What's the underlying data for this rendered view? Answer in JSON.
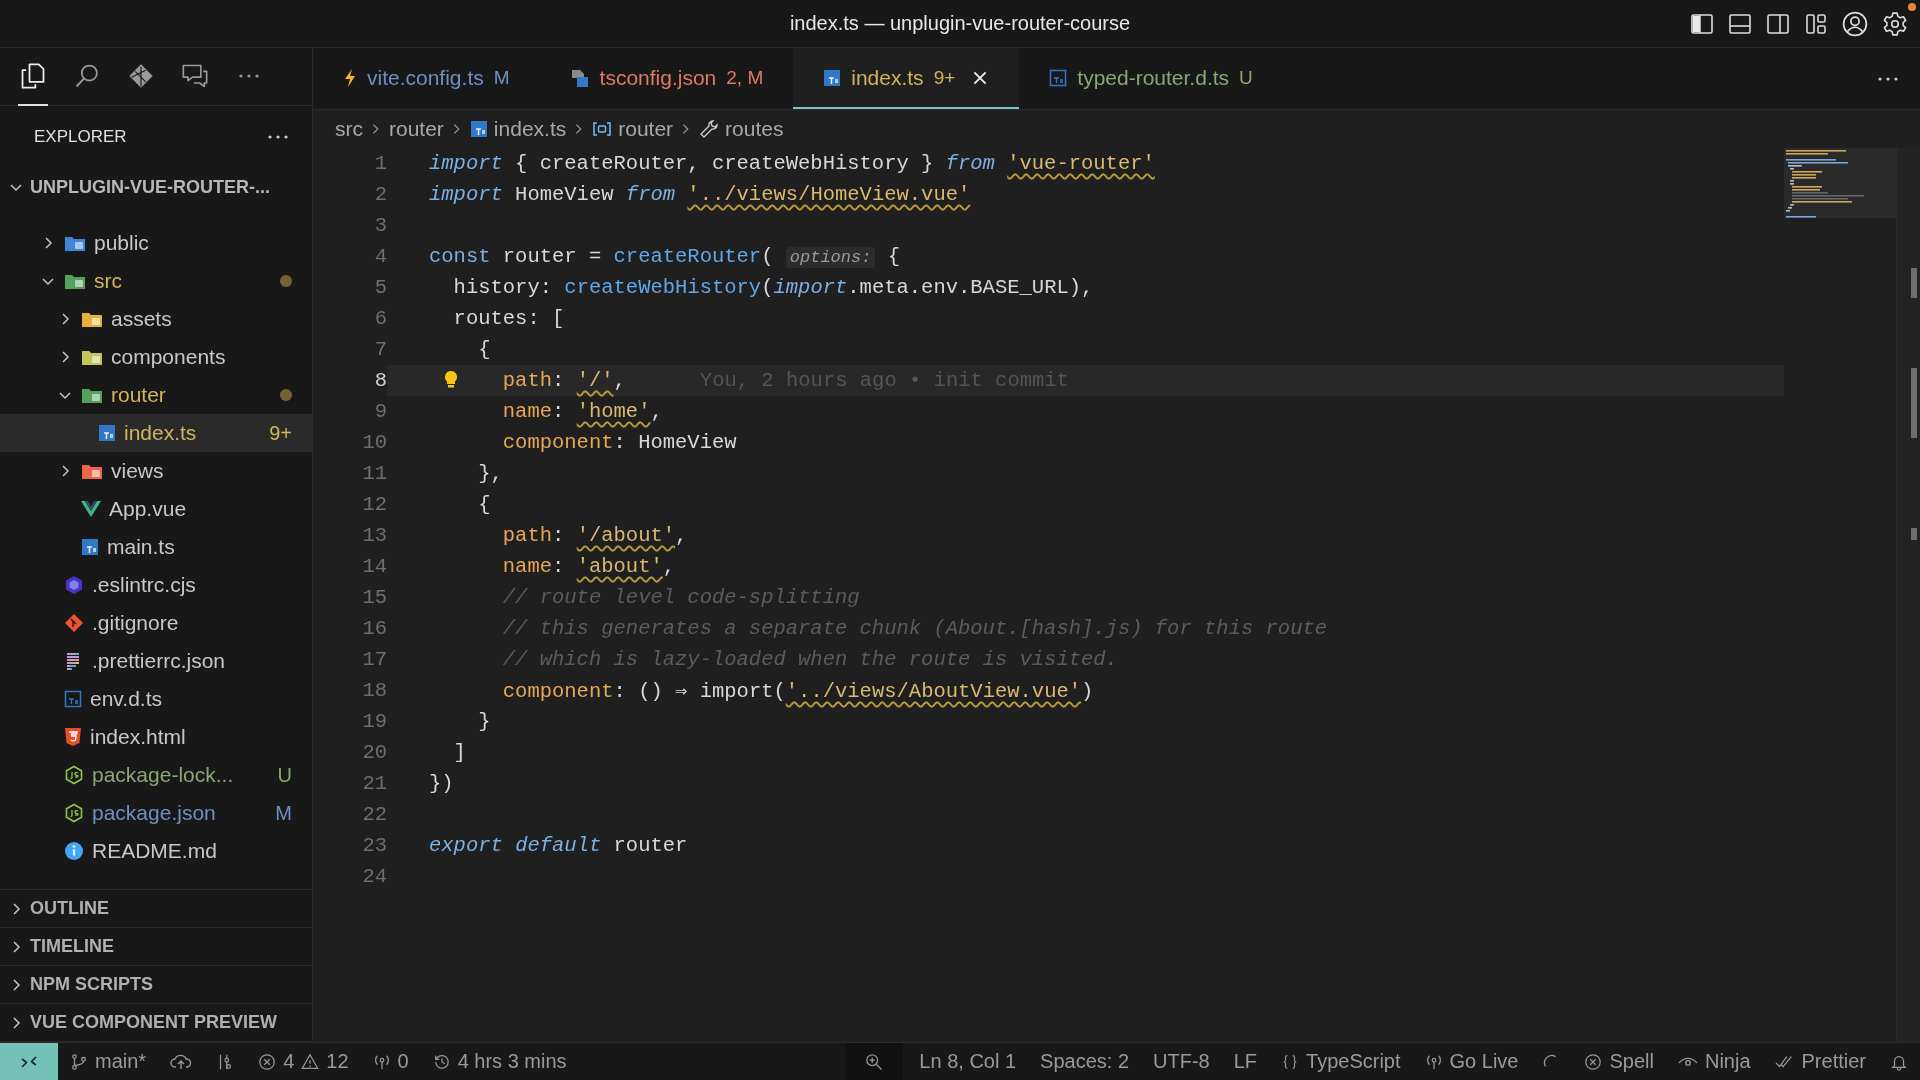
{
  "window": {
    "title": "index.ts — unplugin-vue-router-course"
  },
  "title_actions": [
    {
      "kind": "sidebar",
      "on": true
    },
    {
      "kind": "panel",
      "on": false
    },
    {
      "kind": "split",
      "on": false
    },
    {
      "kind": "layout",
      "on": false
    },
    {
      "kind": "account",
      "on": false
    },
    {
      "kind": "settings",
      "on": false,
      "notify": true
    }
  ],
  "activity": [
    {
      "kind": "files",
      "selected": true
    },
    {
      "kind": "search",
      "selected": false
    },
    {
      "kind": "diamond",
      "selected": false
    },
    {
      "kind": "chat",
      "selected": false
    },
    {
      "kind": "more",
      "selected": false
    }
  ],
  "explorer": {
    "title": "EXPLORER",
    "root": {
      "label": "UNPLUGIN-VUE-ROUTER-...",
      "expanded": true
    },
    "items": [
      {
        "label": "public",
        "kind": "folder-web",
        "expanded": false,
        "selected": false
      },
      {
        "label": "src",
        "kind": "folder-code",
        "expanded": true,
        "color": "#d2b45a",
        "dot": true,
        "selected": false,
        "children": [
          {
            "label": "assets",
            "kind": "folder-assets",
            "expanded": false,
            "selected": false
          },
          {
            "label": "components",
            "kind": "folder-components",
            "expanded": false,
            "selected": false
          },
          {
            "label": "router",
            "kind": "folder-router",
            "expanded": true,
            "color": "#d2b45a",
            "dot": true,
            "selected": false,
            "children": [
              {
                "label": "index.ts",
                "kind": "ts",
                "color": "#d2b45a",
                "badge": "9+",
                "selected": true
              }
            ]
          },
          {
            "label": "views",
            "kind": "folder-views",
            "expanded": false,
            "selected": false
          },
          {
            "label": "App.vue",
            "kind": "vue",
            "selected": false
          },
          {
            "label": "main.ts",
            "kind": "ts",
            "selected": false
          }
        ]
      },
      {
        "label": ".eslintrc.cjs",
        "kind": "eslint",
        "selected": false
      },
      {
        "label": ".gitignore",
        "kind": "git",
        "selected": false
      },
      {
        "label": ".prettierrc.json",
        "kind": "prettier",
        "selected": false
      },
      {
        "label": "env.d.ts",
        "kind": "ts-outline",
        "selected": false
      },
      {
        "label": "index.html",
        "kind": "html",
        "selected": false
      },
      {
        "label": "package-lock...",
        "kind": "node",
        "color": "#8aa672",
        "badge": "U",
        "selected": false
      },
      {
        "label": "package.json",
        "kind": "node",
        "color": "#6f8fc4",
        "badge": "M",
        "selected": false
      },
      {
        "label": "README.md",
        "kind": "info",
        "selected": false
      }
    ]
  },
  "sections": [
    {
      "label": "OUTLINE",
      "expanded": false
    },
    {
      "label": "TIMELINE",
      "expanded": false
    },
    {
      "label": "NPM SCRIPTS",
      "expanded": false
    },
    {
      "label": "VUE COMPONENT PREVIEW",
      "expanded": false
    }
  ],
  "tabs": [
    {
      "label": "vite.config.ts",
      "status": "M",
      "color": "#6f8fc4",
      "kind": "bolt",
      "selected": false
    },
    {
      "label": "tsconfig.json",
      "status": "2, M",
      "color": "#e07a62",
      "kind": "tsconfig",
      "selected": false
    },
    {
      "label": "index.ts",
      "status": "9+",
      "color": "#d2b45a",
      "kind": "ts",
      "selected": true
    },
    {
      "label": "typed-router.d.ts",
      "status": "U",
      "color": "#8aa672",
      "kind": "ts-outline",
      "selected": false
    }
  ],
  "breadcrumbs": [
    {
      "label": "src"
    },
    {
      "label": "router"
    },
    {
      "label": "index.ts",
      "kind": "ts"
    },
    {
      "label": "router",
      "kind": "symbol"
    },
    {
      "label": "routes",
      "kind": "wrench"
    }
  ],
  "editor": {
    "lines": [
      {
        "number": "1",
        "current": false,
        "tokens": [
          {
            "kind": "kw",
            "text": "import"
          },
          {
            "kind": "plain",
            "text": " { createRouter, createWebHistory } "
          },
          {
            "kind": "kw",
            "text": "from "
          },
          {
            "kind": "str",
            "text": "'vue-router'",
            "squiggle": true
          }
        ]
      },
      {
        "number": "2",
        "current": false,
        "tokens": [
          {
            "kind": "kw",
            "text": "import"
          },
          {
            "kind": "plain",
            "text": " HomeView "
          },
          {
            "kind": "kw",
            "text": "from "
          },
          {
            "kind": "str",
            "text": "'../views/HomeView.vue'",
            "squiggle": true
          }
        ]
      },
      {
        "number": "3",
        "current": false
      },
      {
        "number": "4",
        "current": false,
        "tokens": [
          {
            "kind": "decl",
            "text": "const"
          },
          {
            "kind": "plain",
            "text": " router = "
          },
          {
            "kind": "fn",
            "text": "createRouter"
          },
          {
            "kind": "plain",
            "text": "( "
          },
          {
            "kind": "hint",
            "text": "options:"
          },
          {
            "kind": "plain",
            "text": " {"
          }
        ]
      },
      {
        "number": "5",
        "current": false,
        "tokens": [
          {
            "kind": "plain",
            "text": "  history: "
          },
          {
            "kind": "fn",
            "text": "createWebHistory"
          },
          {
            "kind": "plain",
            "text": "("
          },
          {
            "kind": "kw",
            "text": "import"
          },
          {
            "kind": "plain",
            "text": ".meta.env.BASE_URL),"
          }
        ]
      },
      {
        "number": "6",
        "current": false,
        "tokens": [
          {
            "kind": "plain",
            "text": "  routes: ["
          }
        ]
      },
      {
        "number": "7",
        "current": false,
        "tokens": [
          {
            "kind": "plain",
            "text": "    {"
          }
        ]
      },
      {
        "number": "8",
        "current": true,
        "lightbulb": true,
        "blame": "You, 2 hours ago • init commit",
        "tokens": [
          {
            "kind": "prop",
            "text": "      path"
          },
          {
            "kind": "plain",
            "text": ": "
          },
          {
            "kind": "str",
            "text": "'/'",
            "squiggle": true
          },
          {
            "kind": "plain",
            "text": ","
          }
        ]
      },
      {
        "number": "9",
        "current": false,
        "tokens": [
          {
            "kind": "prop",
            "text": "      name"
          },
          {
            "kind": "plain",
            "text": ": "
          },
          {
            "kind": "str",
            "text": "'home'",
            "squiggle": true
          },
          {
            "kind": "plain",
            "text": ","
          }
        ]
      },
      {
        "number": "10",
        "current": false,
        "tokens": [
          {
            "kind": "prop",
            "text": "      component"
          },
          {
            "kind": "plain",
            "text": ": HomeView"
          }
        ]
      },
      {
        "number": "11",
        "current": false,
        "tokens": [
          {
            "kind": "plain",
            "text": "    },"
          }
        ]
      },
      {
        "number": "12",
        "current": false,
        "tokens": [
          {
            "kind": "plain",
            "text": "    {"
          }
        ]
      },
      {
        "number": "13",
        "current": false,
        "tokens": [
          {
            "kind": "prop",
            "text": "      path"
          },
          {
            "kind": "plain",
            "text": ": "
          },
          {
            "kind": "str",
            "text": "'/about'",
            "squiggle": true
          },
          {
            "kind": "plain",
            "text": ","
          }
        ]
      },
      {
        "number": "14",
        "current": false,
        "tokens": [
          {
            "kind": "prop",
            "text": "      name"
          },
          {
            "kind": "plain",
            "text": ": "
          },
          {
            "kind": "str",
            "text": "'about'",
            "squiggle": true
          },
          {
            "kind": "plain",
            "text": ","
          }
        ]
      },
      {
        "number": "15",
        "current": false,
        "tokens": [
          {
            "kind": "comment",
            "text": "      // route level code-splitting"
          }
        ]
      },
      {
        "number": "16",
        "current": false,
        "tokens": [
          {
            "kind": "comment",
            "text": "      // this generates a separate chunk (About.[hash].js) for this route"
          }
        ]
      },
      {
        "number": "17",
        "current": false,
        "tokens": [
          {
            "kind": "comment",
            "text": "      // which is lazy-loaded when the route is visited."
          }
        ]
      },
      {
        "number": "18",
        "current": false,
        "tokens": [
          {
            "kind": "prop",
            "text": "      component"
          },
          {
            "kind": "plain",
            "text": ": () ⇒ import("
          },
          {
            "kind": "str",
            "text": "'../views/AboutView.vue'",
            "squiggle": true
          },
          {
            "kind": "plain",
            "text": ")"
          }
        ]
      },
      {
        "number": "19",
        "current": false,
        "tokens": [
          {
            "kind": "plain",
            "text": "    }"
          }
        ]
      },
      {
        "number": "20",
        "current": false,
        "tokens": [
          {
            "kind": "plain",
            "text": "  ]"
          }
        ]
      },
      {
        "number": "21",
        "current": false,
        "tokens": [
          {
            "kind": "plain",
            "text": "})"
          }
        ]
      },
      {
        "number": "22",
        "current": false
      },
      {
        "number": "23",
        "current": false,
        "tokens": [
          {
            "kind": "kw",
            "text": "export "
          },
          {
            "kind": "kw",
            "text": "default"
          },
          {
            "kind": "plain",
            "text": " router"
          }
        ]
      },
      {
        "number": "24",
        "current": false
      }
    ]
  },
  "status_bar": {
    "left": [
      {
        "kind": "remote"
      },
      {
        "kind": "branch",
        "text": "main*"
      },
      {
        "kind": "sync"
      },
      {
        "kind": "graph"
      },
      {
        "kind": "problems",
        "errors": "4",
        "warnings": "12"
      },
      {
        "kind": "ports",
        "text": "0"
      },
      {
        "kind": "clock",
        "text": "4 hrs 3 mins"
      }
    ],
    "right": [
      {
        "kind": "zoom"
      },
      {
        "kind": "text",
        "text": "Ln 8, Col 1"
      },
      {
        "kind": "text",
        "text": "Spaces: 2"
      },
      {
        "kind": "text",
        "text": "UTF-8"
      },
      {
        "kind": "text",
        "text": "LF"
      },
      {
        "kind": "language",
        "text": "TypeScript"
      },
      {
        "kind": "golive",
        "text": "Go Live"
      },
      {
        "kind": "spinner"
      },
      {
        "kind": "spell",
        "text": "Spell"
      },
      {
        "kind": "ninja",
        "text": "Ninja"
      },
      {
        "kind": "prettier",
        "text": "Prettier"
      },
      {
        "kind": "bell"
      }
    ]
  }
}
